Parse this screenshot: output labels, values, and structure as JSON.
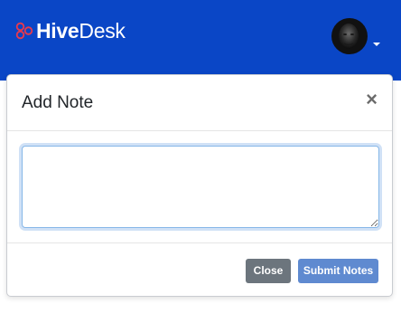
{
  "header": {
    "brand_bold": "Hive",
    "brand_light": "Desk",
    "colors": {
      "background": "#0a46c6",
      "logo_mark": "#e8394d"
    },
    "avatar_icon": "user-avatar",
    "menu_icon": "caret-down-icon"
  },
  "modal": {
    "title": "Add Note",
    "close_icon_glyph": "×",
    "note": {
      "value": "",
      "placeholder": ""
    },
    "buttons": {
      "close_label": "Close",
      "submit_label": "Submit Notes"
    },
    "colors": {
      "close_button": "#6c757d",
      "submit_button": "#5f8ad0",
      "focus_ring": "#86b7e8"
    }
  }
}
